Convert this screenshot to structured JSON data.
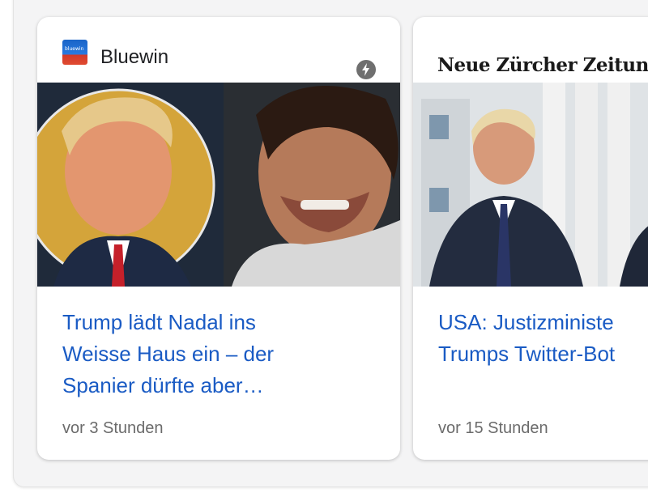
{
  "cards": [
    {
      "source": "Bluewin",
      "source_logo_text": "bluewin",
      "headline": "Trump lädt Nadal ins\nWeisse Haus ein – der\nSpanier dürfte aber…",
      "time": "vor 3 Stunden",
      "amp_icon": "lightning-bolt"
    },
    {
      "source": "Neue Zürcher Zeitung",
      "headline": "USA: Justizministe\nTrumps Twitter-Bot",
      "time": "vor 15 Stunden"
    }
  ],
  "colors": {
    "headline": "#1a5bc4",
    "timestamp": "#6b6b6b",
    "background": "#f4f4f5"
  }
}
